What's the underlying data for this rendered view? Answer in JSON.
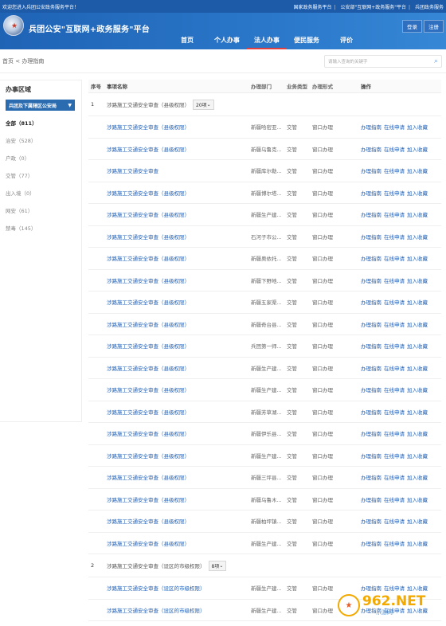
{
  "top": {
    "welcome": "欢迎您进入兵团公安政务服务平台！",
    "links": [
      "国家政务服务平台",
      "公安部\"互联网+政务服务\"平台",
      "兵团政务服务"
    ]
  },
  "header": {
    "title": "兵团公安\"互联网+政务服务\"平台",
    "login": "登录",
    "register": "注册",
    "nav": [
      {
        "label": "首页"
      },
      {
        "label": "个人办事"
      },
      {
        "label": "法人办事"
      },
      {
        "label": "便民服务"
      },
      {
        "label": "评价"
      }
    ],
    "active_nav": "法人办事"
  },
  "breadcrumb": "首页 < 办理指南",
  "search": {
    "placeholder": "请输入查询的关键字"
  },
  "sidebar": {
    "title": "办事区域",
    "area": "兵团及下属辖区公安局",
    "categories": [
      "全部（811）",
      "治安（528）",
      "户政（0）",
      "交管（77）",
      "出入境（0）",
      "网安（61）",
      "禁毒（145）"
    ]
  },
  "table": {
    "headers": {
      "no": "序号",
      "name": "事项名称",
      "dept": "办理部门",
      "type": "业务类型",
      "form": "办理形式",
      "ops": "操作"
    },
    "ops": [
      "办理指南",
      "在线申请",
      "加入收藏"
    ],
    "groups": [
      {
        "no": "1",
        "name": "涉路施工交通安全审查（县级权限）",
        "count": "20项",
        "items": [
          {
            "name": "涉路施工交通安全审查（县级权限）",
            "dept": "新疆哈密亚...",
            "type": "交管",
            "form": "窗口办理"
          },
          {
            "name": "涉路施工交通安全审查（县级权限）",
            "dept": "新疆乌鲁克...",
            "type": "交管",
            "form": "窗口办理"
          },
          {
            "name": "涉路施工交通安全审查",
            "dept": "新疆库尔勒...",
            "type": "交管",
            "form": "窗口办理"
          },
          {
            "name": "涉路施工交通安全审查（县级权限）",
            "dept": "新疆博尔塔...",
            "type": "交管",
            "form": "窗口办理"
          },
          {
            "name": "涉路施工交通安全审查（县级权限）",
            "dept": "新疆生产建...",
            "type": "交管",
            "form": "窗口办理"
          },
          {
            "name": "涉路施工交通安全审查（县级权限）",
            "dept": "石河子市公...",
            "type": "交管",
            "form": "窗口办理"
          },
          {
            "name": "涉路施工交通安全审查（县级权限）",
            "dept": "新疆奥依托...",
            "type": "交管",
            "form": "窗口办理"
          },
          {
            "name": "涉路施工交通安全审查（县级权限）",
            "dept": "新疆下野地...",
            "type": "交管",
            "form": "窗口办理"
          },
          {
            "name": "涉路施工交通安全审查（县级权限）",
            "dept": "新疆五家渠...",
            "type": "交管",
            "form": "窗口办理"
          },
          {
            "name": "涉路施工交通安全审查（县级权限）",
            "dept": "新疆奇台县...",
            "type": "交管",
            "form": "窗口办理"
          },
          {
            "name": "涉路施工交通安全审查（县级权限）",
            "dept": "兵团第一师...",
            "type": "交管",
            "form": "窗口办理"
          },
          {
            "name": "涉路施工交通安全审查（县级权限）",
            "dept": "新疆生产建...",
            "type": "交管",
            "form": "窗口办理"
          },
          {
            "name": "涉路施工交通安全审查（县级权限）",
            "dept": "新疆生产建...",
            "type": "交管",
            "form": "窗口办理"
          },
          {
            "name": "涉路施工交通安全审查（县级权限）",
            "dept": "新疆芳草湖...",
            "type": "交管",
            "form": "窗口办理"
          },
          {
            "name": "涉路施工交通安全审查（县级权限）",
            "dept": "新疆伊乐县...",
            "type": "交管",
            "form": "窗口办理"
          },
          {
            "name": "涉路施工交通安全审查（县级权限）",
            "dept": "新疆生产建...",
            "type": "交管",
            "form": "窗口办理"
          },
          {
            "name": "涉路施工交通安全审查（县级权限）",
            "dept": "新疆三坪县...",
            "type": "交管",
            "form": "窗口办理"
          },
          {
            "name": "涉路施工交通安全审查（县级权限）",
            "dept": "新疆乌鲁木...",
            "type": "交管",
            "form": "窗口办理"
          },
          {
            "name": "涉路施工交通安全审查（县级权限）",
            "dept": "新疆柏坪镇...",
            "type": "交管",
            "form": "窗口办理"
          },
          {
            "name": "涉路施工交通安全审查（县级权限）",
            "dept": "新疆生产建...",
            "type": "交管",
            "form": "窗口办理"
          }
        ]
      },
      {
        "no": "2",
        "name": "涉路施工交通安全审查（设区的市级权限）",
        "count": "8项",
        "items": [
          {
            "name": "涉路施工交通安全审查（设区的市级权限）",
            "dept": "新疆生产建...",
            "type": "交管",
            "form": "窗口办理"
          },
          {
            "name": "涉路施工交通安全审查（设区的市级权限）",
            "dept": "新疆生产建...",
            "type": "交管",
            "form": "窗口办理"
          }
        ]
      }
    ]
  },
  "watermark": {
    "brand": "962.NET",
    "sub": "乐游网"
  }
}
